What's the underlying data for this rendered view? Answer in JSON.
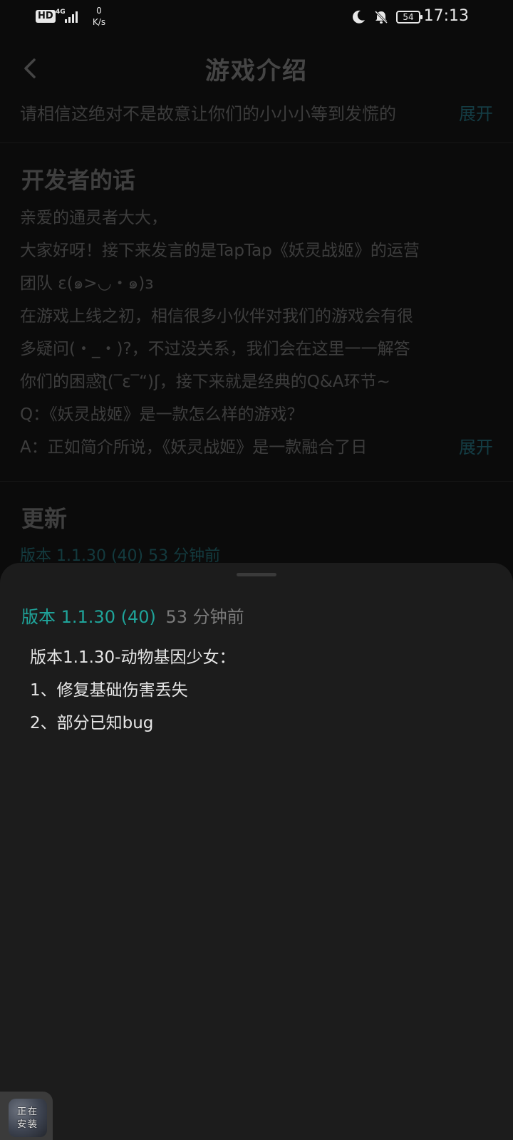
{
  "status_bar": {
    "hd": "HD",
    "network": "4G",
    "speed_value": "0",
    "speed_unit": "K/s",
    "battery": "54",
    "time": "17:13"
  },
  "page": {
    "title": "游戏介绍",
    "intro_text": "请相信这绝对不是故意让你们的小小小等到发慌的",
    "expand_label": "展开",
    "developer_heading": "开发者的话",
    "developer_lines": [
      "亲爱的通灵者大大，",
      "大家好呀！接下来发言的是TapTap《妖灵战姬》的运营",
      "团队 ε(๑>◡・๑)з",
      "在游戏上线之初，相信很多小伙伴对我们的游戏会有很",
      "多疑问(・_・)?，不过没关系，我们会在这里一一解答",
      "你们的困惑ƪ(‾ε‾“)ʃ，接下来就是经典的Q&A环节~",
      "Q：《妖灵战姬》是一款怎么样的游戏？",
      "A：正如简介所说，《妖灵战姬》是一款融合了日"
    ],
    "developer_expand_label": "展开",
    "update_heading": "更新",
    "update_peek": "版本 1.1.30 (40) 53 分钟前"
  },
  "sheet": {
    "version_label": "版本 1.1.30 (40)",
    "version_time": "53 分钟前",
    "notes": [
      "版本1.1.30-动物基因少女：",
      "1、修复基础伤害丢失",
      "2、部分已知bug"
    ]
  },
  "install_widget": {
    "line1": "正在",
    "line2": "安装"
  }
}
